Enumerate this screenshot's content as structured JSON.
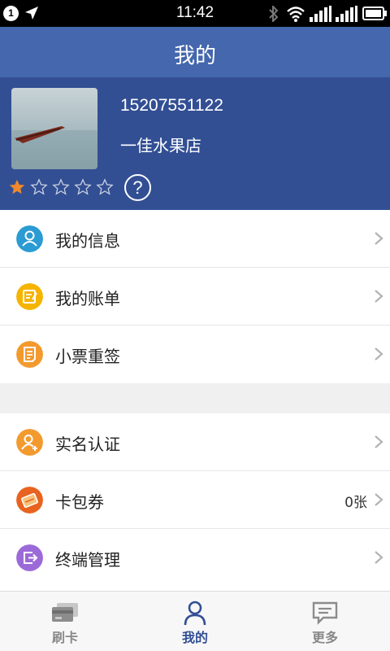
{
  "status_bar": {
    "notification_count": "1",
    "time": "11:42",
    "icons": [
      "location-arrow-icon",
      "bluetooth-icon",
      "wifi-icon",
      "signal-icon",
      "signal-icon",
      "battery-icon"
    ]
  },
  "header": {
    "title": "我的"
  },
  "profile": {
    "phone": "15207551122",
    "shop_name": "一佳水果店",
    "rating": {
      "filled": 1,
      "total": 5
    },
    "help_label": "?"
  },
  "menu_group_1": [
    {
      "label": "我的信息",
      "icon": "user-icon",
      "color": "#2b9bd3"
    },
    {
      "label": "我的账单",
      "icon": "bill-icon",
      "color": "#f5b400"
    },
    {
      "label": "小票重签",
      "icon": "receipt-icon",
      "color": "#f39a2e"
    }
  ],
  "menu_group_2": [
    {
      "label": "实名认证",
      "icon": "add-user-icon",
      "color": "#f39a2e",
      "value": ""
    },
    {
      "label": "卡包券",
      "icon": "card-wallet-icon",
      "color": "#e8631f",
      "value": "0张"
    },
    {
      "label": "终端管理",
      "icon": "terminal-icon",
      "color": "#9b6ad8",
      "value": ""
    }
  ],
  "tabs": [
    {
      "label": "刷卡",
      "icon": "card-swipe-icon",
      "active": false
    },
    {
      "label": "我的",
      "icon": "person-icon",
      "active": true
    },
    {
      "label": "更多",
      "icon": "chat-more-icon",
      "active": false
    }
  ],
  "colors": {
    "header_blue": "#4467ad",
    "profile_blue": "#324f94",
    "star_orange": "#f0892c",
    "tab_active": "#324f94"
  }
}
